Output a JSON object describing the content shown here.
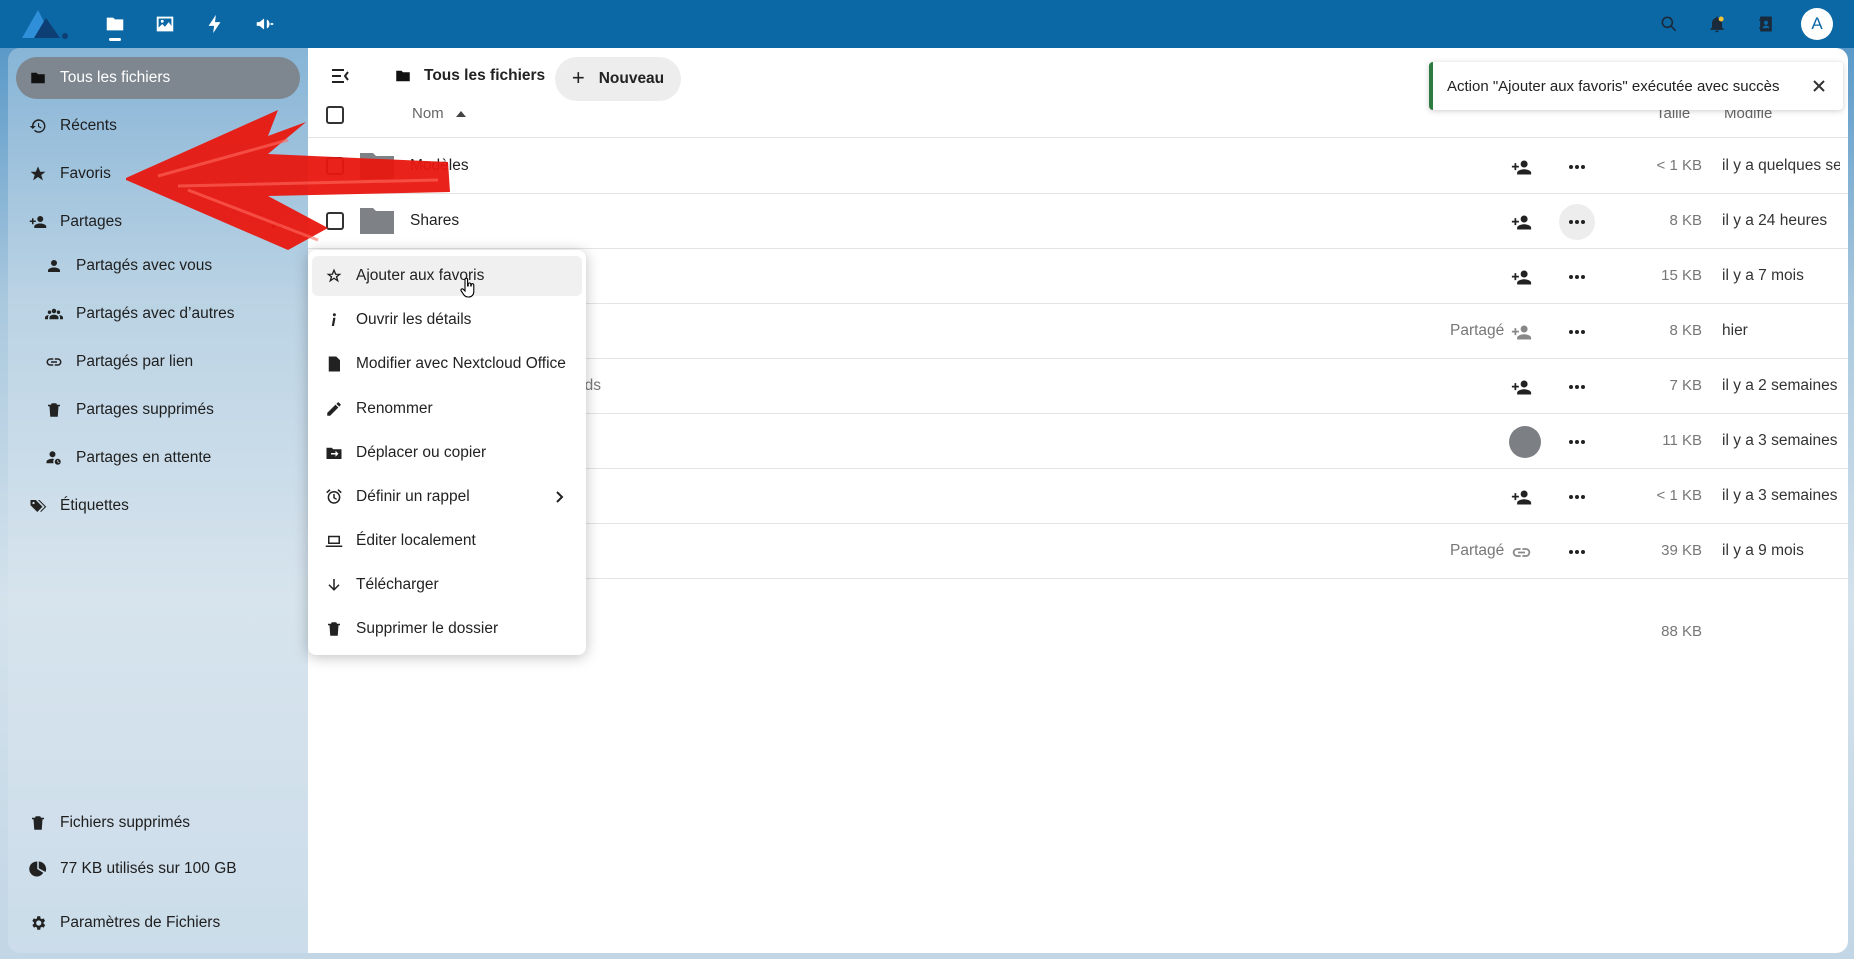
{
  "topbar": {
    "apps": [
      {
        "name": "files-app-icon"
      },
      {
        "name": "photos-app-icon"
      },
      {
        "name": "activity-app-icon"
      },
      {
        "name": "announcements-app-icon"
      }
    ],
    "avatar_letter": "A"
  },
  "sidebar": {
    "items": [
      {
        "label": "Tous les fichiers"
      },
      {
        "label": "Récents"
      },
      {
        "label": "Favoris"
      },
      {
        "label": "Partages"
      },
      {
        "label": "Partagés avec vous"
      },
      {
        "label": "Partagés avec d’autres"
      },
      {
        "label": "Partagés par lien"
      },
      {
        "label": "Partages supprimés"
      },
      {
        "label": "Partages en attente"
      },
      {
        "label": "Étiquettes"
      }
    ],
    "footer": {
      "trash": "Fichiers supprimés",
      "quota": "77 KB utilisés sur 100 GB",
      "settings": "Paramètres de Fichiers"
    }
  },
  "header": {
    "breadcrumb": "Tous les fichiers",
    "new_label": "Nouveau"
  },
  "toast": {
    "message": "Action \"Ajouter aux favoris\" exécutée avec succès"
  },
  "table": {
    "col_name": "Nom",
    "col_size": "Taille",
    "col_modified": "Modifié",
    "rows": [
      {
        "name": "Modèles",
        "frag": "",
        "shared": "",
        "size": "< 1 KB",
        "modified": "il y a quelques secondes"
      },
      {
        "name": "Shares",
        "frag": "",
        "shared": "",
        "size": "8 KB",
        "modified": "il y a 24 heures"
      },
      {
        "name": "",
        "frag": "",
        "shared": "",
        "size": "15 KB",
        "modified": "il y a 7 mois"
      },
      {
        "name": "",
        "frag": "",
        "shared": "Partagé",
        "size": "8 KB",
        "modified": "hier"
      },
      {
        "name": "",
        "frag": "ods",
        "shared": "",
        "size": "7 KB",
        "modified": "il y a 2 semaines"
      },
      {
        "name": "",
        "frag": "",
        "shared": "",
        "size": "11 KB",
        "modified": "il y a 3 semaines"
      },
      {
        "name": "",
        "frag": "",
        "shared": "",
        "size": "< 1 KB",
        "modified": "il y a 3 semaines"
      },
      {
        "name": "",
        "frag": "",
        "shared": "Partagé",
        "size": "39 KB",
        "modified": "il y a 9 mois"
      }
    ],
    "total_size": "88 KB"
  },
  "menu": {
    "items": [
      {
        "label": "Ajouter aux favoris"
      },
      {
        "label": "Ouvrir les détails"
      },
      {
        "label": "Modifier avec Nextcloud Office"
      },
      {
        "label": "Renommer"
      },
      {
        "label": "Déplacer ou copier"
      },
      {
        "label": "Définir un rappel"
      },
      {
        "label": "Éditer localement"
      },
      {
        "label": "Télécharger"
      },
      {
        "label": "Supprimer le dossier"
      }
    ]
  }
}
